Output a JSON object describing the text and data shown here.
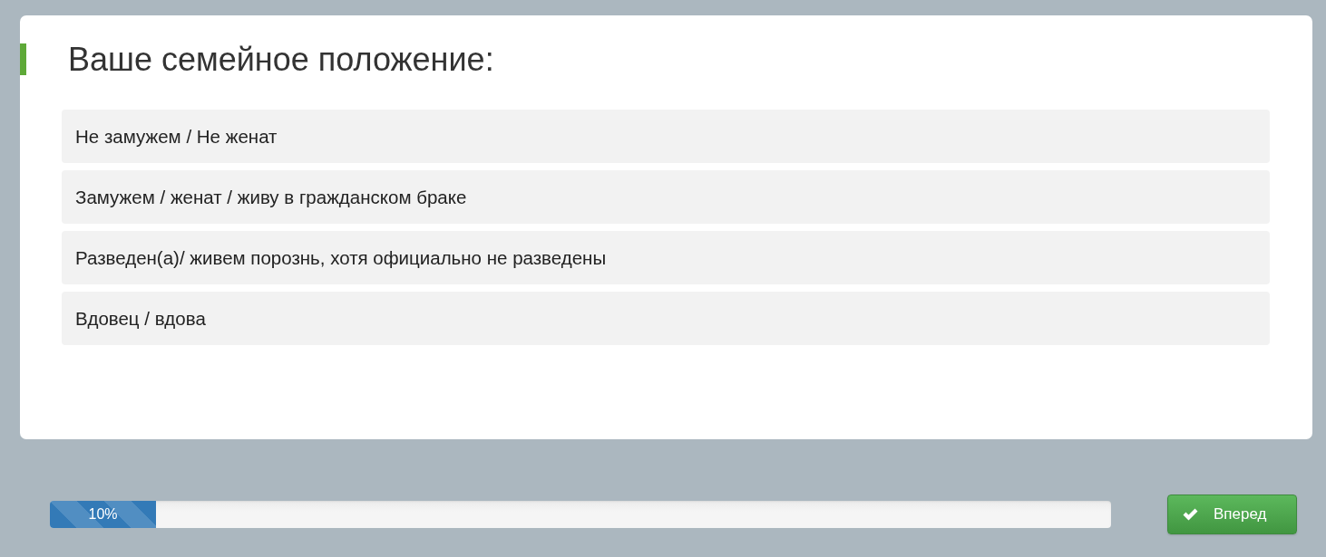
{
  "question": {
    "title": "Ваше семейное положение:"
  },
  "options": [
    {
      "label": "Не замужем / Не женат",
      "selected": false
    },
    {
      "label": "Замужем / женат / живу в гражданском браке",
      "selected": false
    },
    {
      "label": "Разведен(а)/ живем порознь, хотя официально не разведены",
      "selected": false
    },
    {
      "label": "Вдовец / вдова",
      "selected": false
    }
  ],
  "progress": {
    "level": 0.1,
    "label": "10%"
  },
  "next_button": {
    "label": "Вперед"
  }
}
